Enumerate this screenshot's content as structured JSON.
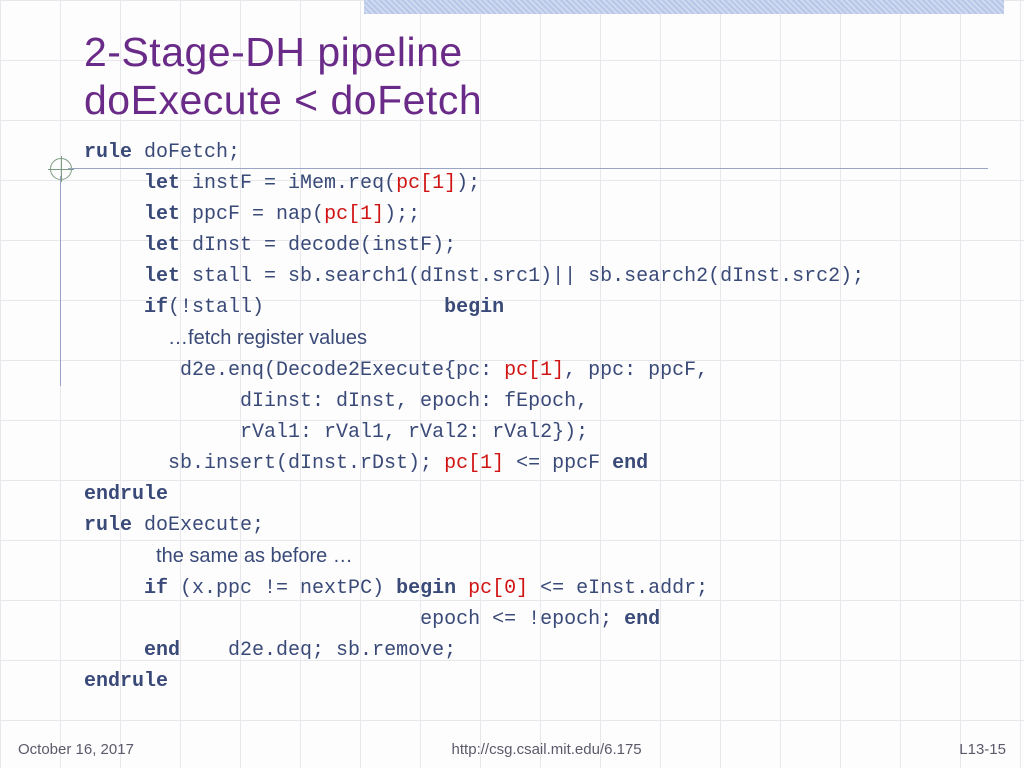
{
  "title_line1": "2-Stage-DH pipeline",
  "title_line2": "doExecute < doFetch",
  "code": {
    "kw_rule": "rule",
    "kw_let": "let",
    "kw_if": "if",
    "kw_begin": "begin",
    "kw_end": "end",
    "kw_endrule": "endrule",
    "doFetch_name": " doFetch;",
    "l2a": " instF = iMem.req(",
    "pc1": "pc[1]",
    "l2b": ");",
    "l3a": " ppcF = nap(",
    "l3b": ");;",
    "l4": " dInst = decode(instF);",
    "l5": " stall = sb.search1(dInst.src1)|| sb.search2(dInst.src2);",
    "l6": "(!stall)               ",
    "note_fetch": "…fetch register values",
    "l7a": "d2e.enq(Decode2Execute{pc: ",
    "l7b": ", ppc: ppcF,",
    "l8": "dIinst: dInst, epoch: fEpoch,",
    "l9": "rVal1: rVal1, rVal2: rVal2});",
    "l10a": "sb.insert(dInst.rDst); ",
    "l10b": " <= ppcF ",
    "doExecute_name": " doExecute;",
    "note_same": "the same as before …",
    "l12a": " (x.ppc != nextPC) ",
    "pc0": "pc[0]",
    "l12b": " <= eInst.addr;",
    "l13": "epoch <= !epoch; ",
    "l14": "    d2e.deq; sb.remove;"
  },
  "footer": {
    "date": "October 16, 2017",
    "url": "http://csg.csail.mit.edu/6.175",
    "page": "L13-15"
  }
}
